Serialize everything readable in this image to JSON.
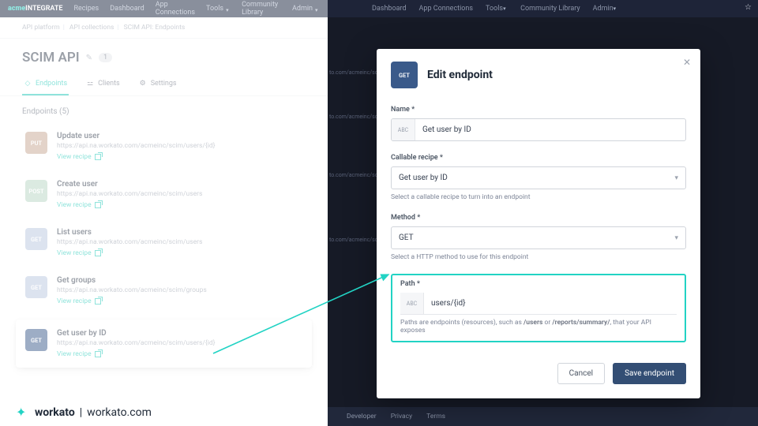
{
  "left": {
    "brand_a": "acme",
    "brand_b": "INTEGRATE",
    "nav": [
      "Recipes",
      "Dashboard",
      "App Connections",
      "Tools",
      "Community Library",
      "Admin"
    ],
    "nav_dropdown": [
      false,
      false,
      false,
      true,
      false,
      true
    ],
    "breadcrumb": [
      "API platform",
      "API collections",
      "SCIM API: Endpoints"
    ],
    "page_title": "SCIM API",
    "count": "1",
    "tabs": [
      {
        "icon": "node-icon",
        "label": "Endpoints"
      },
      {
        "icon": "people-icon",
        "label": "Clients"
      },
      {
        "icon": "gear-icon",
        "label": "Settings"
      }
    ],
    "section_head": "Endpoints (5)",
    "endpoints": [
      {
        "method": "PUT",
        "cls": "m-put",
        "name": "Update user",
        "url": "https://api.na.workato.com/acmeinc/scim/users/{id}",
        "view": "View recipe"
      },
      {
        "method": "POST",
        "cls": "m-post",
        "name": "Create user",
        "url": "https://api.na.workato.com/acmeinc/scim/users",
        "view": "View recipe"
      },
      {
        "method": "GET",
        "cls": "m-get",
        "name": "List users",
        "url": "https://api.na.workato.com/acmeinc/scim/users",
        "view": "View recipe"
      },
      {
        "method": "GET",
        "cls": "m-get",
        "name": "Get groups",
        "url": "https://api.na.workato.com/acmeinc/scim/groups",
        "view": "View recipe"
      },
      {
        "method": "GET",
        "cls": "m-get-dark",
        "name": "Get user by ID",
        "url": "https://api.na.workato.com/acmeinc/scim/users/{id}",
        "view": "View recipe",
        "raised": true
      }
    ]
  },
  "watermark": {
    "brand": "workato",
    "site": "workato.com"
  },
  "right": {
    "nav": [
      "Dashboard",
      "App Connections",
      "Tools",
      "Community Library",
      "Admin"
    ],
    "nav_dropdown": [
      false,
      false,
      true,
      false,
      true
    ],
    "footer": [
      "Developer",
      "Privacy",
      "Terms"
    ]
  },
  "modal": {
    "method": "GET",
    "title": "Edit endpoint",
    "name_label": "Name",
    "name_value": "Get user by ID",
    "recipe_label": "Callable recipe",
    "recipe_value": "Get user by ID",
    "recipe_help": "Select a callable recipe to turn into an endpoint",
    "method_label": "Method",
    "method_value": "GET",
    "method_help": "Select a HTTP method to use for this endpoint",
    "path_label": "Path",
    "path_value": "users/{id}",
    "path_help_a": "Paths are endpoints (resources), such as ",
    "path_help_b": "/users",
    "path_help_c": " or ",
    "path_help_d": "/reports/summary/",
    "path_help_e": ", that your API exposes",
    "cancel": "Cancel",
    "save": "Save endpoint"
  }
}
